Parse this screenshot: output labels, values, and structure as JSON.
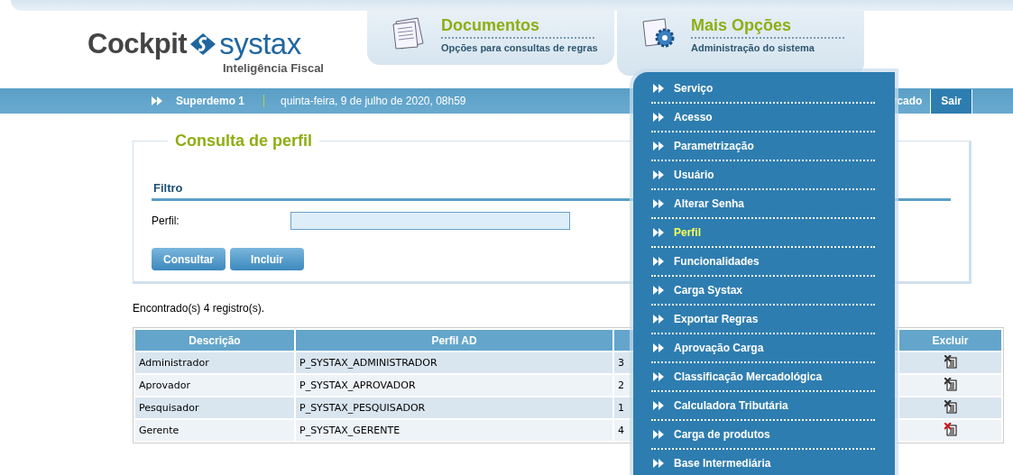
{
  "logo": {
    "word_1": "Cockpit",
    "word_2": "systax",
    "tagline": "Inteligência Fiscal"
  },
  "nav_tabs": [
    {
      "title": "Documentos",
      "subtitle": "Opções para consultas de regras",
      "selected": false,
      "kind": "documents"
    },
    {
      "title": "Mais Opções",
      "subtitle": "Administração do sistema",
      "selected": true,
      "kind": "settings"
    }
  ],
  "user_bar": {
    "user": "Superdemo 1",
    "datetime": "quinta-feira, 9 de julho de 2020, 08h59",
    "partial_link": "rcado",
    "logout": "Sair"
  },
  "menu": {
    "items": [
      {
        "label": "Serviço",
        "selected": false
      },
      {
        "label": "Acesso",
        "selected": false
      },
      {
        "label": "Parametrização",
        "selected": false
      },
      {
        "label": "Usuário",
        "selected": false
      },
      {
        "label": "Alterar Senha",
        "selected": false
      },
      {
        "label": "Perfil",
        "selected": true
      },
      {
        "label": "Funcionalidades",
        "selected": false
      },
      {
        "label": "Carga Systax",
        "selected": false
      },
      {
        "label": "Exportar Regras",
        "selected": false
      },
      {
        "label": "Aprovação Carga",
        "selected": false
      },
      {
        "label": "Classificação Mercadológica",
        "selected": false
      },
      {
        "label": "Calculadora Tributária",
        "selected": false
      },
      {
        "label": "Carga de produtos",
        "selected": false
      },
      {
        "label": "Base Intermediária",
        "selected": false
      }
    ]
  },
  "form": {
    "title": "Consulta de perfil",
    "section": "Filtro",
    "field_label": "Perfil:",
    "buttons": [
      "Consultar",
      "Incluir"
    ]
  },
  "result_text": "Encontrado(s) 4 registro(s).",
  "table": {
    "columns": [
      "Descrição",
      "Perfil AD",
      "",
      "Excluir"
    ],
    "rows": [
      {
        "descricao": "Administrador",
        "perfil_ad": "P_SYSTAX_ADMINISTRADOR",
        "column_3": "3",
        "delete_highlighted": false
      },
      {
        "descricao": "Aprovador",
        "perfil_ad": "P_SYSTAX_APROVADOR",
        "column_3": "2",
        "delete_highlighted": false
      },
      {
        "descricao": "Pesquisador",
        "perfil_ad": "P_SYSTAX_PESQUISADOR",
        "column_3": "1",
        "delete_highlighted": false
      },
      {
        "descricao": "Gerente",
        "perfil_ad": "P_SYSTAX_GERENTE",
        "column_3": "4",
        "delete_highlighted": true
      }
    ]
  }
}
